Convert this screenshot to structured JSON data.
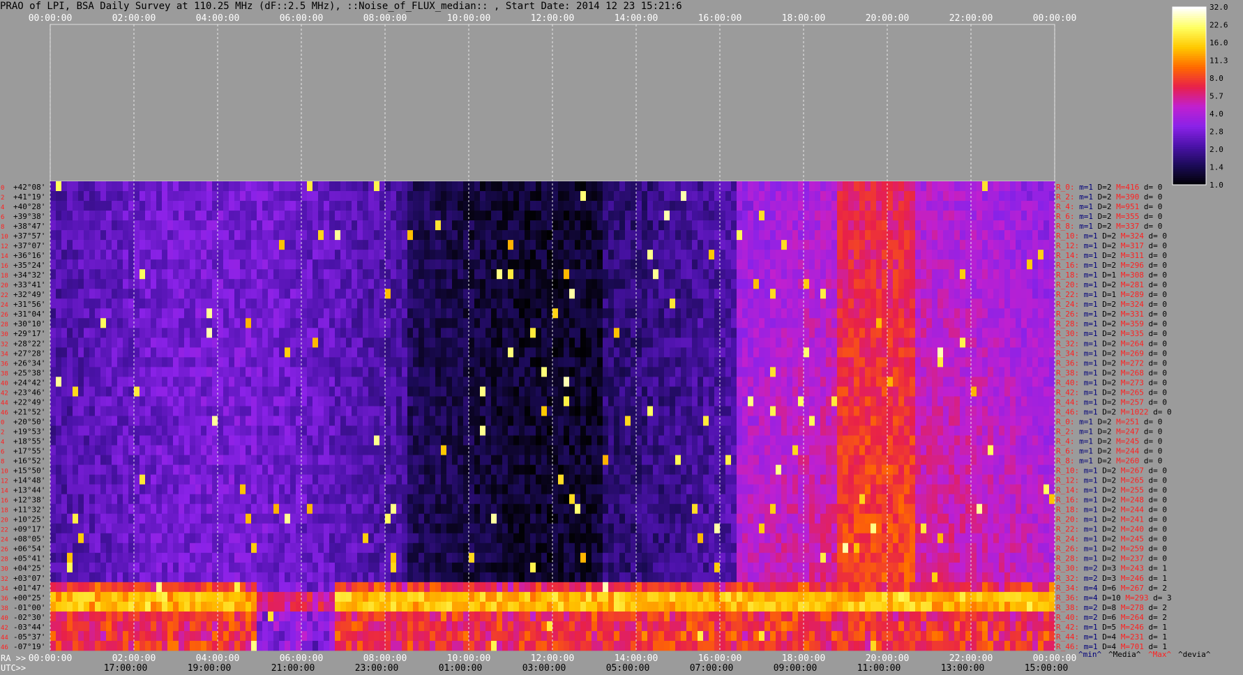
{
  "title": "PRAO of LPI, BSA Daily Survey at 110.25 MHz (dF::2.5 MHz), ::Noise_of_FLUX_median:: , Start Date: 2014 12 23 15:21:6",
  "chart_data": {
    "type": "heatmap",
    "top_axis_ticks": [
      "00:00:00",
      "02:00:00",
      "04:00:00",
      "06:00:00",
      "08:00:00",
      "10:00:00",
      "12:00:00",
      "14:00:00",
      "16:00:00",
      "18:00:00",
      "20:00:00",
      "22:00:00",
      "00:00:00"
    ],
    "ra_axis_label": "RA >>",
    "ra_ticks": [
      "00:00:00",
      "02:00:00",
      "04:00:00",
      "06:00:00",
      "08:00:00",
      "10:00:00",
      "12:00:00",
      "14:00:00",
      "16:00:00",
      "18:00:00",
      "20:00:00",
      "22:00:00",
      "00:00:00"
    ],
    "utc_axis_label": "UTC>>",
    "utc_ticks": [
      "17:00:00",
      "19:00:00",
      "21:00:00",
      "23:00:00",
      "01:00:00",
      "03:00:00",
      "05:00:00",
      "07:00:00",
      "09:00:00",
      "11:00:00",
      "13:00:00",
      "15:00:00"
    ],
    "row_indices": [
      "0",
      "2",
      "4",
      "6",
      "8",
      "10",
      "12",
      "14",
      "16",
      "18",
      "20",
      "22",
      "24",
      "26",
      "28",
      "30",
      "32",
      "34",
      "36",
      "38",
      "40",
      "42",
      "44",
      "46",
      "0",
      "2",
      "4",
      "6",
      "8",
      "10",
      "12",
      "14",
      "16",
      "18",
      "20",
      "22",
      "24",
      "26",
      "28",
      "30",
      "32",
      "34",
      "36",
      "38",
      "40",
      "42",
      "44",
      "46"
    ],
    "declinations": [
      "+42°08'",
      "+41°19'",
      "+40°28'",
      "+39°38'",
      "+38°47'",
      "+37°57'",
      "+37°07'",
      "+36°16'",
      "+35°24'",
      "+34°32'",
      "+33°41'",
      "+32°49'",
      "+31°56'",
      "+31°04'",
      "+30°10'",
      "+29°17'",
      "+28°22'",
      "+27°28'",
      "+26°34'",
      "+25°38'",
      "+24°42'",
      "+23°46'",
      "+22°49'",
      "+21°52'",
      "+20°50'",
      "+19°53'",
      "+18°55'",
      "+17°55'",
      "+16°52'",
      "+15°50'",
      "+14°48'",
      "+13°44'",
      "+12°38'",
      "+11°32'",
      "+10°25'",
      "+09°17'",
      "+08°05'",
      "+06°54'",
      "+05°41'",
      "+04°25'",
      "+03°07'",
      "+01°47'",
      "+00°25'",
      "-01°00'",
      "-02°30'",
      "-03°44'",
      "-05°37'",
      "-07°19'"
    ],
    "color_scale": {
      "ticks": [
        "32.0",
        "22.6",
        "16.0",
        "11.3",
        "8.0",
        "5.7",
        "4.0",
        "2.8",
        "2.0",
        "1.4",
        "1.0"
      ],
      "colors": [
        "#000000",
        "#1a0a55",
        "#4a12a8",
        "#8a22e8",
        "#c020d0",
        "#e8204a",
        "#ff6a00",
        "#ffc800",
        "#ffff60",
        "#ffffff"
      ]
    },
    "beam_stats_header": [
      "^min^",
      "^Media^",
      "^Max^",
      "^devia^"
    ],
    "beam_stats": [
      {
        "label": "R_0:",
        "m": "m=1",
        "d": "D=2",
        "max": "M=416",
        "dev": "d= 0"
      },
      {
        "label": "R_2:",
        "m": "m=1",
        "d": "D=2",
        "max": "M=390",
        "dev": "d= 0"
      },
      {
        "label": "R_4:",
        "m": "m=1",
        "d": "D=2",
        "max": "M=951",
        "dev": "d= 0"
      },
      {
        "label": "R_6:",
        "m": "m=1",
        "d": "D=2",
        "max": "M=355",
        "dev": "d= 0"
      },
      {
        "label": "R_8:",
        "m": "m=1",
        "d": "D=2",
        "max": "M=337",
        "dev": "d= 0"
      },
      {
        "label": "R_10:",
        "m": "m=1",
        "d": "D=2",
        "max": "M=324",
        "dev": "d= 0"
      },
      {
        "label": "R_12:",
        "m": "m=1",
        "d": "D=2",
        "max": "M=317",
        "dev": "d= 0"
      },
      {
        "label": "R_14:",
        "m": "m=1",
        "d": "D=2",
        "max": "M=311",
        "dev": "d= 0"
      },
      {
        "label": "R_16:",
        "m": "m=1",
        "d": "D=2",
        "max": "M=296",
        "dev": "d= 0"
      },
      {
        "label": "R_18:",
        "m": "m=1",
        "d": "D=1",
        "max": "M=308",
        "dev": "d= 0"
      },
      {
        "label": "R_20:",
        "m": "m=1",
        "d": "D=2",
        "max": "M=281",
        "dev": "d= 0"
      },
      {
        "label": "R_22:",
        "m": "m=1",
        "d": "D=1",
        "max": "M=289",
        "dev": "d= 0"
      },
      {
        "label": "R_24:",
        "m": "m=1",
        "d": "D=2",
        "max": "M=324",
        "dev": "d= 0"
      },
      {
        "label": "R_26:",
        "m": "m=1",
        "d": "D=2",
        "max": "M=331",
        "dev": "d= 0"
      },
      {
        "label": "R_28:",
        "m": "m=1",
        "d": "D=2",
        "max": "M=359",
        "dev": "d= 0"
      },
      {
        "label": "R_30:",
        "m": "m=1",
        "d": "D=2",
        "max": "M=335",
        "dev": "d= 0"
      },
      {
        "label": "R_32:",
        "m": "m=1",
        "d": "D=2",
        "max": "M=264",
        "dev": "d= 0"
      },
      {
        "label": "R_34:",
        "m": "m=1",
        "d": "D=2",
        "max": "M=269",
        "dev": "d= 0"
      },
      {
        "label": "R_36:",
        "m": "m=1",
        "d": "D=2",
        "max": "M=272",
        "dev": "d= 0"
      },
      {
        "label": "R_38:",
        "m": "m=1",
        "d": "D=2",
        "max": "M=268",
        "dev": "d= 0"
      },
      {
        "label": "R_40:",
        "m": "m=1",
        "d": "D=2",
        "max": "M=273",
        "dev": "d= 0"
      },
      {
        "label": "R_42:",
        "m": "m=1",
        "d": "D=2",
        "max": "M=265",
        "dev": "d= 0"
      },
      {
        "label": "R_44:",
        "m": "m=1",
        "d": "D=2",
        "max": "M=257",
        "dev": "d= 0"
      },
      {
        "label": "R_46:",
        "m": "m=1",
        "d": "D=2",
        "max": "M=1022",
        "dev": "d= 0"
      },
      {
        "label": "R_0:",
        "m": "m=1",
        "d": "D=2",
        "max": "M=251",
        "dev": "d= 0"
      },
      {
        "label": "R_2:",
        "m": "m=1",
        "d": "D=2",
        "max": "M=247",
        "dev": "d= 0"
      },
      {
        "label": "R_4:",
        "m": "m=1",
        "d": "D=2",
        "max": "M=245",
        "dev": "d= 0"
      },
      {
        "label": "R_6:",
        "m": "m=1",
        "d": "D=2",
        "max": "M=244",
        "dev": "d= 0"
      },
      {
        "label": "R_8:",
        "m": "m=1",
        "d": "D=2",
        "max": "M=260",
        "dev": "d= 0"
      },
      {
        "label": "R_10:",
        "m": "m=1",
        "d": "D=2",
        "max": "M=267",
        "dev": "d= 0"
      },
      {
        "label": "R_12:",
        "m": "m=1",
        "d": "D=2",
        "max": "M=265",
        "dev": "d= 0"
      },
      {
        "label": "R_14:",
        "m": "m=1",
        "d": "D=2",
        "max": "M=255",
        "dev": "d= 0"
      },
      {
        "label": "R_16:",
        "m": "m=1",
        "d": "D=2",
        "max": "M=248",
        "dev": "d= 0"
      },
      {
        "label": "R_18:",
        "m": "m=1",
        "d": "D=2",
        "max": "M=244",
        "dev": "d= 0"
      },
      {
        "label": "R_20:",
        "m": "m=1",
        "d": "D=2",
        "max": "M=241",
        "dev": "d= 0"
      },
      {
        "label": "R_22:",
        "m": "m=1",
        "d": "D=2",
        "max": "M=240",
        "dev": "d= 0"
      },
      {
        "label": "R_24:",
        "m": "m=1",
        "d": "D=2",
        "max": "M=245",
        "dev": "d= 0"
      },
      {
        "label": "R_26:",
        "m": "m=1",
        "d": "D=2",
        "max": "M=259",
        "dev": "d= 0"
      },
      {
        "label": "R_28:",
        "m": "m=1",
        "d": "D=2",
        "max": "M=237",
        "dev": "d= 0"
      },
      {
        "label": "R_30:",
        "m": "m=2",
        "d": "D=3",
        "max": "M=243",
        "dev": "d= 1"
      },
      {
        "label": "R_32:",
        "m": "m=2",
        "d": "D=3",
        "max": "M=246",
        "dev": "d= 1"
      },
      {
        "label": "R_34:",
        "m": "m=4",
        "d": "D=6",
        "max": "M=267",
        "dev": "d= 2"
      },
      {
        "label": "R_36:",
        "m": "m=4",
        "d": "D=10",
        "max": "M=293",
        "dev": "d= 3"
      },
      {
        "label": "R_38:",
        "m": "m=2",
        "d": "D=8",
        "max": "M=278",
        "dev": "d= 2"
      },
      {
        "label": "R_40:",
        "m": "m=2",
        "d": "D=6",
        "max": "M=264",
        "dev": "d= 2"
      },
      {
        "label": "R_42:",
        "m": "m=1",
        "d": "D=5",
        "max": "M=246",
        "dev": "d= 1"
      },
      {
        "label": "R_44:",
        "m": "m=1",
        "d": "D=4",
        "max": "M=231",
        "dev": "d= 1"
      },
      {
        "label": "R_46:",
        "m": "m=1",
        "d": "D=4",
        "max": "M=701",
        "dev": "d= 1"
      }
    ]
  }
}
